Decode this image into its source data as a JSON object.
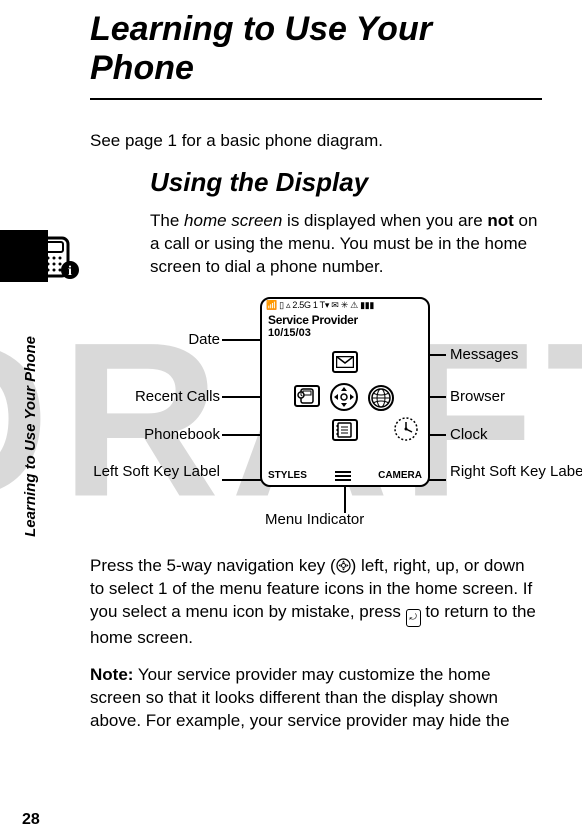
{
  "watermark": "DRAFT",
  "page_number": "28",
  "side_tab": "Learning to Use Your Phone",
  "chapter_title": "Learning to Use Your Phone",
  "section_title": "Using the Display",
  "intro_text": "See page 1 for a basic phone diagram.",
  "home_screen_para_1": "The ",
  "home_screen_term": "home screen",
  "home_screen_para_2": " is displayed when you are ",
  "home_screen_bold": "not",
  "home_screen_para_3": " on a call or using the menu. You must be in the home screen to dial a phone number.",
  "nav_para_1": "Press the 5-way navigation key (",
  "nav_para_2": ") left, right, up, or down to select 1 of the menu feature icons in the home screen. If you select a menu icon by mistake, press ",
  "nav_para_3": " to return to the home screen.",
  "esc_glyph": "⤾",
  "note_label": "Note:",
  "note_text": " Your service provider may customize the home screen so that it looks different than the display shown above. For example, your service provider may hide the",
  "phoneinfo_icon_label": "ℹ",
  "diagram": {
    "status_icons": "📶 ▯ ▵ 2.5G 1   T▾ ✉ ✳ ⚠ ▮▮▮",
    "provider": "Service Provider",
    "date": "10/15/03",
    "soft_left": "STYLES",
    "soft_right": "CAMERA",
    "labels": {
      "date": "Date",
      "recent_calls": "Recent Calls",
      "phonebook": "Phonebook",
      "left_soft": "Left Soft Key Label",
      "menu_indicator": "Menu Indicator",
      "messages": "Messages",
      "browser": "Browser",
      "clock": "Clock",
      "right_soft": "Right Soft Key Label"
    }
  }
}
